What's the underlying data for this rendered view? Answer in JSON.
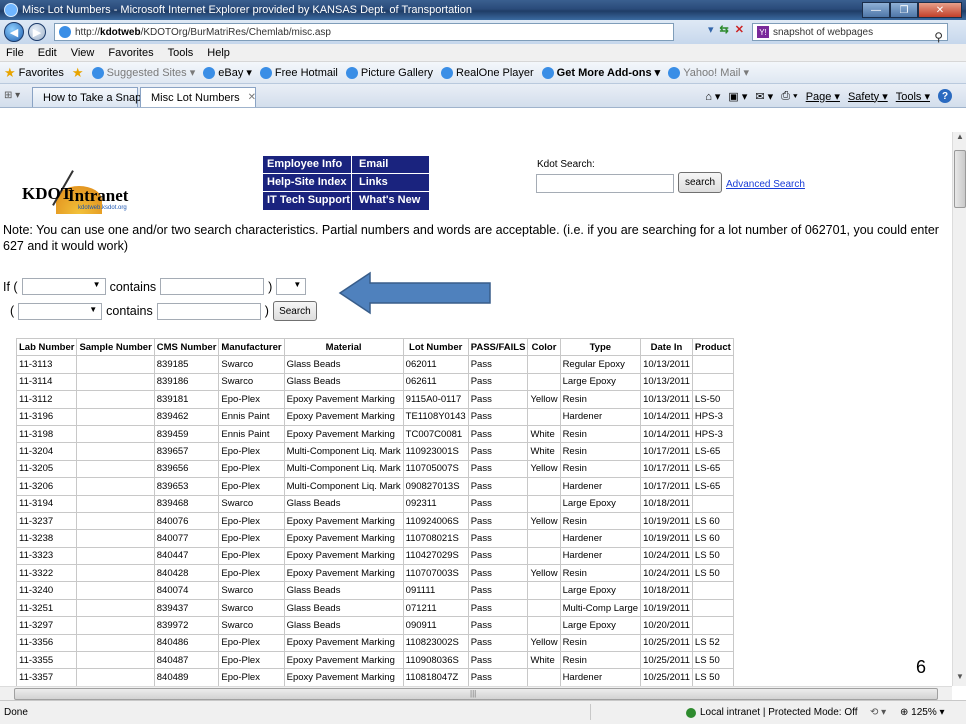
{
  "window": {
    "title": "Misc Lot Numbers - Microsoft Internet Explorer provided by KANSAS Dept. of Transportation"
  },
  "address_bar": {
    "url_prefix": "http://",
    "url_host": "kdotweb",
    "url_path": "/KDOTOrg/BurMatriRes/Chemlab/misc.asp",
    "search_text": "snapshot of webpages",
    "search_engine_icon": "yahoo-icon"
  },
  "menu": [
    "File",
    "Edit",
    "View",
    "Favorites",
    "Tools",
    "Help"
  ],
  "favorites_bar": {
    "favorites_label": "Favorites",
    "items": [
      {
        "label": "Suggested Sites ▾",
        "style": "muted"
      },
      {
        "label": "eBay ▾",
        "style": "normal"
      },
      {
        "label": "Free Hotmail",
        "style": "normal"
      },
      {
        "label": "Picture Gallery",
        "style": "normal"
      },
      {
        "label": "RealOne Player",
        "style": "normal"
      },
      {
        "label": "Get More Add-ons ▾",
        "style": "bold"
      },
      {
        "label": "Yahoo! Mail ▾",
        "style": "muted"
      }
    ]
  },
  "tabs": [
    {
      "label": "How to Take a Snap...",
      "active": false
    },
    {
      "label": "Misc Lot Numbers",
      "active": true
    }
  ],
  "command_bar": {
    "page": "Page ▾",
    "safety": "Safety ▾",
    "tools": "Tools ▾"
  },
  "logo": {
    "kdot": "KDOT",
    "intranet": "Intranet",
    "sub": "kdotweb.ksdot.org"
  },
  "nav_links": {
    "employee_info": "Employee Info",
    "email": "Email",
    "help_site_index": "Help-Site Index",
    "links": "Links",
    "it_tech_support": "IT Tech Support",
    "whats_new": "What's New"
  },
  "kdot_search": {
    "label": "Kdot Search:",
    "button": "search",
    "advanced": "Advanced Search"
  },
  "note": "Note: You can use one and/or two search characteristics. Partial numbers and words are acceptable. (i.e. if you are searching for a lot number of 062701, you could enter 627 and it would work)",
  "search_form": {
    "if_label": "If (",
    "open_paren": "(",
    "contains1": "contains",
    "contains2": "contains",
    "close_paren": ")",
    "button": "Search"
  },
  "table": {
    "headers": [
      "Lab Number",
      "Sample Number",
      "CMS Number",
      "Manufacturer",
      "Material",
      "Lot Number",
      "PASS/FAILS",
      "Color",
      "Type",
      "Date In",
      "Product"
    ],
    "rows": [
      [
        "11-3113",
        "",
        "839185",
        "Swarco",
        "Glass Beads",
        "062011",
        "Pass",
        "",
        "Regular Epoxy",
        "10/13/2011",
        ""
      ],
      [
        "11-3114",
        "",
        "839186",
        "Swarco",
        "Glass Beads",
        "062611",
        "Pass",
        "",
        "Large Epoxy",
        "10/13/2011",
        ""
      ],
      [
        "11-3112",
        "",
        "839181",
        "Epo-Plex",
        "Epoxy Pavement Marking",
        "9115A0-0117",
        "Pass",
        "Yellow",
        "Resin",
        "10/13/2011",
        "LS-50"
      ],
      [
        "11-3196",
        "",
        "839462",
        "Ennis Paint",
        "Epoxy Pavement Marking",
        "TE1108Y0143",
        "Pass",
        "",
        "Hardener",
        "10/14/2011",
        "HPS-3"
      ],
      [
        "11-3198",
        "",
        "839459",
        "Ennis Paint",
        "Epoxy Pavement Marking",
        "TC007C0081",
        "Pass",
        "White",
        "Resin",
        "10/14/2011",
        "HPS-3"
      ],
      [
        "11-3204",
        "",
        "839657",
        "Epo-Plex",
        "Multi-Component Liq. Mark",
        "110923001S",
        "Pass",
        "White",
        "Resin",
        "10/17/2011",
        "LS-65"
      ],
      [
        "11-3205",
        "",
        "839656",
        "Epo-Plex",
        "Multi-Component Liq. Mark",
        "110705007S",
        "Pass",
        "Yellow",
        "Resin",
        "10/17/2011",
        "LS-65"
      ],
      [
        "11-3206",
        "",
        "839653",
        "Epo-Plex",
        "Multi-Component Liq. Mark",
        "090827013S",
        "Pass",
        "",
        "Hardener",
        "10/17/2011",
        "LS-65"
      ],
      [
        "11-3194",
        "",
        "839468",
        "Swarco",
        "Glass Beads",
        "092311",
        "Pass",
        "",
        "Large Epoxy",
        "10/18/2011",
        ""
      ],
      [
        "11-3237",
        "",
        "840076",
        "Epo-Plex",
        "Epoxy Pavement Marking",
        "110924006S",
        "Pass",
        "Yellow",
        "Resin",
        "10/19/2011",
        "LS 60"
      ],
      [
        "11-3238",
        "",
        "840077",
        "Epo-Plex",
        "Epoxy Pavement Marking",
        "110708021S",
        "Pass",
        "",
        "Hardener",
        "10/19/2011",
        "LS 60"
      ],
      [
        "11-3323",
        "",
        "840447",
        "Epo-Plex",
        "Epoxy Pavement Marking",
        "110427029S",
        "Pass",
        "",
        "Hardener",
        "10/24/2011",
        "LS 50"
      ],
      [
        "11-3322",
        "",
        "840428",
        "Epo-Plex",
        "Epoxy Pavement Marking",
        "110707003S",
        "Pass",
        "Yellow",
        "Resin",
        "10/24/2011",
        "LS 50"
      ],
      [
        "11-3240",
        "",
        "840074",
        "Swarco",
        "Glass Beads",
        "091111",
        "Pass",
        "",
        "Large Epoxy",
        "10/18/2011",
        ""
      ],
      [
        "11-3251",
        "",
        "839437",
        "Swarco",
        "Glass Beads",
        "071211",
        "Pass",
        "",
        "Multi-Comp Large",
        "10/19/2011",
        ""
      ],
      [
        "11-3297",
        "",
        "839972",
        "Swarco",
        "Glass Beads",
        "090911",
        "Pass",
        "",
        "Large Epoxy",
        "10/20/2011",
        ""
      ],
      [
        "11-3356",
        "",
        "840486",
        "Epo-Plex",
        "Epoxy Pavement Marking",
        "110823002S",
        "Pass",
        "Yellow",
        "Resin",
        "10/25/2011",
        "LS 52"
      ],
      [
        "11-3355",
        "",
        "840487",
        "Epo-Plex",
        "Epoxy Pavement Marking",
        "110908036S",
        "Pass",
        "White",
        "Resin",
        "10/25/2011",
        "LS 50"
      ],
      [
        "11-3357",
        "",
        "840489",
        "Epo-Plex",
        "Epoxy Pavement Marking",
        "110818047Z",
        "Pass",
        "",
        "Hardener",
        "10/25/2011",
        "LS 50"
      ]
    ]
  },
  "slide_number": "6",
  "status_bar": {
    "status": "Done",
    "zone": "Local intranet | Protected Mode: Off",
    "zoom": "125%"
  }
}
